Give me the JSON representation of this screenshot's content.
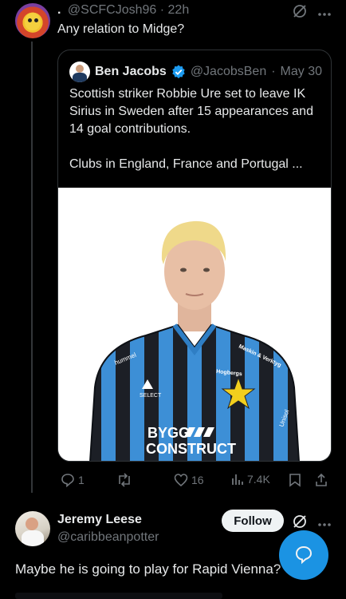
{
  "reply": {
    "display_name": ".",
    "handle": "@SCFCJosh96",
    "separator": "·",
    "time": "22h",
    "text": "Any relation to Midge?"
  },
  "quote": {
    "name": "Ben Jacobs",
    "handle": "@JacobsBen",
    "separator": "·",
    "date": "May 30",
    "paragraph1": "Scottish striker Robbie Ure set to leave IK Sirius in Sweden after 15 appearances and 14 goal contributions.",
    "paragraph2": "Clubs in England, France and Portugal ...",
    "photo": {
      "sponsor_line1": "BYGG",
      "sponsor_line2": "CONSTRUCT",
      "brand_left": "hummel",
      "brand_chest": "SELECT",
      "sponsor_right": "Hogbergs",
      "sponsor_shoulder": "Maskin & Verktyg",
      "sleeve": "Unisol"
    }
  },
  "actions": {
    "replies": "1",
    "reposts": "",
    "likes": "16",
    "views": "7.4K"
  },
  "second_reply": {
    "name": "Jeremy Leese",
    "handle": "@caribbeanpotter",
    "follow_label": "Follow",
    "text": "Maybe he is going to play for Rapid Vienna?"
  },
  "colors": {
    "background": "#000000",
    "text": "#e7e9ea",
    "muted": "#71767b",
    "accent": "#1d9bf0"
  },
  "icons": [
    "grok-icon",
    "more-icon",
    "verified-badge-icon",
    "reply-icon",
    "repost-icon",
    "like-icon",
    "views-icon",
    "bookmark-icon",
    "share-icon",
    "compose-icon"
  ]
}
